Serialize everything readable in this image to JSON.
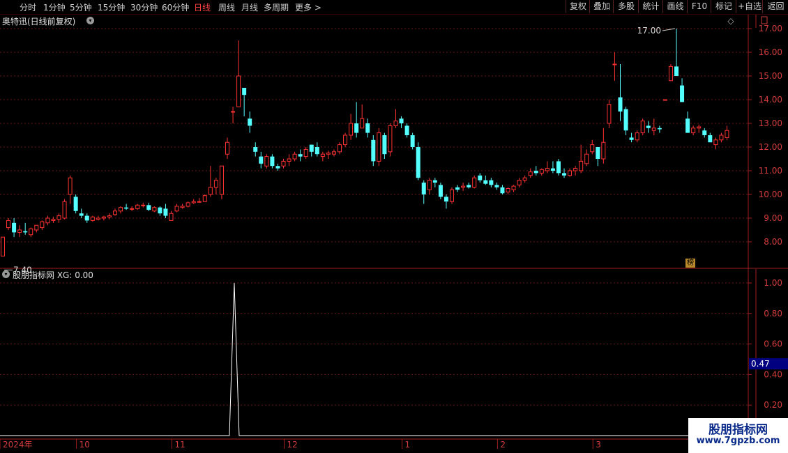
{
  "toolbar": {
    "periods": [
      "分时",
      "1分钟",
      "5分钟",
      "15分钟",
      "30分钟",
      "60分钟",
      "日线",
      "周线",
      "月线",
      "多周期",
      "更多 >"
    ],
    "active_period": "日线",
    "right_buttons": [
      "复权",
      "叠加",
      "多股",
      "统计",
      "画线",
      "F10",
      "标记",
      "+自选",
      "返回"
    ]
  },
  "stock": {
    "title": "奥特迅(日线前复权)"
  },
  "indicator": {
    "title": "股朋指标网 XG: 0.00",
    "current_value": "0.47"
  },
  "badge": "榜",
  "watermark": {
    "line1": "股朋指标网",
    "line2": "www.7gpzb.com"
  },
  "colors": {
    "up": "#ff3232",
    "down": "#54ffff",
    "axis": "#a02020",
    "grid": "#6a1818",
    "line": "#ffffff",
    "highlight": "#000080"
  },
  "chart_data": [
    {
      "type": "candlestick",
      "ylim": [
        7.0,
        17.3
      ],
      "y_ticks": [
        "17.00",
        "16.00",
        "15.00",
        "14.00",
        "13.00",
        "12.00",
        "11.00",
        "10.00",
        "9.00",
        "8.00"
      ],
      "x_labels": [
        "2024年",
        "10",
        "11",
        "12",
        "1",
        "2",
        "3"
      ],
      "x_label_index": [
        0,
        13,
        30,
        50,
        71,
        88,
        105
      ],
      "annotations": {
        "high": "17.00",
        "low": "7.40"
      },
      "ohlc": [
        [
          7.4,
          8.2,
          7.4,
          8.2
        ],
        [
          8.6,
          9.0,
          8.5,
          8.9
        ],
        [
          8.8,
          9.0,
          8.2,
          8.4
        ],
        [
          8.4,
          8.7,
          8.2,
          8.5
        ],
        [
          8.45,
          8.8,
          8.3,
          8.4
        ],
        [
          8.3,
          8.6,
          8.2,
          8.55
        ],
        [
          8.5,
          8.7,
          8.4,
          8.7
        ],
        [
          8.6,
          8.9,
          8.5,
          8.85
        ],
        [
          8.8,
          9.1,
          8.7,
          9.0
        ],
        [
          8.9,
          9.05,
          8.8,
          8.95
        ],
        [
          8.95,
          9.2,
          8.8,
          9.1
        ],
        [
          9.0,
          9.8,
          8.95,
          9.7
        ],
        [
          10.0,
          10.8,
          9.6,
          10.7
        ],
        [
          9.9,
          10.0,
          9.2,
          9.3
        ],
        [
          9.2,
          9.4,
          9.0,
          9.1
        ],
        [
          9.1,
          9.2,
          8.8,
          8.9
        ],
        [
          8.9,
          9.1,
          8.85,
          9.05
        ],
        [
          8.95,
          9.1,
          8.9,
          9.0
        ],
        [
          9.0,
          9.1,
          8.9,
          9.05
        ],
        [
          9.05,
          9.2,
          8.95,
          9.1
        ],
        [
          9.15,
          9.4,
          9.1,
          9.3
        ],
        [
          9.3,
          9.5,
          9.2,
          9.45
        ],
        [
          9.45,
          9.6,
          9.35,
          9.4
        ],
        [
          9.4,
          9.5,
          9.3,
          9.4
        ],
        [
          9.4,
          9.6,
          9.35,
          9.55
        ],
        [
          9.55,
          9.65,
          9.45,
          9.55
        ],
        [
          9.55,
          9.65,
          9.3,
          9.35
        ],
        [
          9.3,
          9.5,
          9.25,
          9.45
        ],
        [
          9.45,
          9.5,
          9.1,
          9.2
        ],
        [
          9.4,
          9.6,
          9.0,
          9.1
        ],
        [
          8.9,
          9.3,
          8.9,
          9.2
        ],
        [
          9.3,
          9.6,
          9.25,
          9.5
        ],
        [
          9.45,
          9.6,
          9.4,
          9.5
        ],
        [
          9.5,
          9.7,
          9.45,
          9.65
        ],
        [
          9.65,
          9.8,
          9.6,
          9.7
        ],
        [
          9.7,
          9.85,
          9.65,
          9.7
        ],
        [
          9.7,
          10.0,
          9.7,
          9.95
        ],
        [
          10.0,
          11.2,
          9.9,
          10.3
        ],
        [
          10.3,
          10.7,
          10.0,
          10.6
        ],
        [
          10.0,
          11.2,
          9.8,
          11.2
        ],
        [
          11.7,
          12.4,
          11.5,
          12.2
        ],
        [
          13.5,
          13.7,
          13.0,
          13.5
        ],
        [
          13.7,
          16.5,
          13.7,
          15.0
        ],
        [
          14.5,
          14.0,
          13.3,
          14.2
        ],
        [
          13.2,
          13.5,
          12.6,
          12.9
        ],
        [
          12.0,
          12.2,
          11.6,
          11.8
        ],
        [
          11.6,
          11.8,
          11.1,
          11.3
        ],
        [
          11.2,
          11.7,
          11.1,
          11.6
        ],
        [
          11.6,
          11.7,
          11.1,
          11.2
        ],
        [
          11.2,
          11.3,
          11.0,
          11.1
        ],
        [
          11.2,
          11.5,
          11.1,
          11.4
        ],
        [
          11.4,
          11.7,
          11.2,
          11.5
        ],
        [
          11.5,
          11.8,
          11.4,
          11.7
        ],
        [
          11.7,
          11.9,
          11.4,
          11.6
        ],
        [
          11.6,
          12.0,
          11.5,
          11.9
        ],
        [
          12.1,
          12.0,
          11.6,
          11.8
        ],
        [
          12.0,
          12.2,
          11.6,
          11.7
        ],
        [
          11.6,
          11.8,
          11.4,
          11.7
        ],
        [
          11.7,
          11.85,
          11.5,
          11.75
        ],
        [
          11.7,
          11.9,
          11.6,
          11.8
        ],
        [
          11.8,
          12.2,
          11.7,
          12.1
        ],
        [
          12.1,
          12.6,
          12.0,
          12.5
        ],
        [
          12.5,
          13.4,
          12.3,
          13.0
        ],
        [
          13.0,
          13.9,
          12.4,
          12.6
        ],
        [
          12.8,
          13.8,
          12.8,
          13.2
        ],
        [
          13.0,
          13.2,
          12.4,
          12.6
        ],
        [
          12.3,
          12.5,
          11.2,
          11.4
        ],
        [
          11.4,
          12.8,
          11.2,
          12.6
        ],
        [
          12.5,
          12.6,
          11.5,
          11.7
        ],
        [
          11.8,
          13.0,
          11.6,
          12.9
        ],
        [
          12.9,
          13.6,
          12.8,
          13.1
        ],
        [
          13.2,
          13.3,
          12.8,
          13.0
        ],
        [
          12.9,
          13.0,
          12.4,
          12.5
        ],
        [
          12.5,
          12.6,
          11.9,
          12.0
        ],
        [
          12.0,
          12.2,
          10.6,
          10.7
        ],
        [
          10.5,
          10.6,
          9.6,
          10.0
        ],
        [
          10.2,
          10.7,
          10.0,
          10.6
        ],
        [
          10.6,
          10.7,
          10.3,
          10.5
        ],
        [
          10.4,
          10.5,
          9.8,
          9.9
        ],
        [
          9.9,
          10.0,
          9.4,
          9.7
        ],
        [
          9.7,
          10.3,
          9.6,
          10.2
        ],
        [
          10.3,
          10.4,
          10.1,
          10.2
        ],
        [
          10.3,
          10.5,
          10.15,
          10.35
        ],
        [
          10.4,
          10.5,
          10.25,
          10.3
        ],
        [
          10.3,
          10.8,
          10.25,
          10.7
        ],
        [
          10.8,
          10.9,
          10.5,
          10.6
        ],
        [
          10.6,
          10.8,
          10.4,
          10.45
        ],
        [
          10.6,
          10.7,
          10.3,
          10.4
        ],
        [
          10.4,
          10.5,
          10.2,
          10.3
        ],
        [
          10.3,
          10.4,
          10.0,
          10.05
        ],
        [
          10.1,
          10.3,
          10.0,
          10.25
        ],
        [
          10.2,
          10.4,
          10.1,
          10.35
        ],
        [
          10.4,
          10.7,
          10.3,
          10.6
        ],
        [
          10.6,
          10.8,
          10.5,
          10.7
        ],
        [
          10.8,
          11.1,
          10.7,
          10.95
        ],
        [
          11.0,
          11.2,
          10.8,
          10.9
        ],
        [
          10.9,
          11.1,
          10.8,
          11.05
        ],
        [
          11.0,
          11.4,
          10.9,
          11.1
        ],
        [
          11.1,
          11.4,
          10.9,
          11.0
        ],
        [
          11.4,
          11.5,
          10.8,
          10.9
        ],
        [
          10.9,
          11.1,
          10.7,
          10.8
        ],
        [
          10.8,
          11.1,
          10.75,
          11.0
        ],
        [
          11.0,
          11.2,
          10.8,
          11.1
        ],
        [
          11.0,
          12.1,
          10.9,
          11.4
        ],
        [
          11.3,
          11.9,
          11.2,
          11.7
        ],
        [
          11.8,
          12.3,
          11.7,
          12.1
        ],
        [
          12.0,
          11.9,
          11.2,
          11.5
        ],
        [
          11.5,
          12.8,
          11.3,
          12.2
        ],
        [
          13.0,
          14.0,
          12.8,
          13.8
        ],
        [
          15.5,
          16.0,
          14.8,
          15.5
        ],
        [
          14.1,
          15.5,
          13.1,
          13.5
        ],
        [
          13.6,
          13.7,
          12.5,
          12.7
        ],
        [
          12.4,
          12.6,
          12.2,
          12.3
        ],
        [
          12.3,
          12.7,
          12.2,
          12.6
        ],
        [
          12.6,
          13.2,
          12.5,
          13.1
        ],
        [
          12.9,
          13.1,
          12.6,
          12.8
        ],
        [
          12.7,
          13.2,
          12.5,
          12.8
        ],
        [
          12.8,
          12.9,
          12.6,
          12.75
        ],
        [
          14.0,
          14.0,
          14.0,
          14.0
        ],
        [
          14.8,
          15.5,
          14.8,
          15.4
        ],
        [
          15.4,
          17.0,
          15.2,
          15.0
        ],
        [
          14.6,
          14.9,
          13.9,
          13.9
        ],
        [
          13.2,
          13.5,
          12.6,
          12.6
        ],
        [
          12.6,
          12.9,
          12.5,
          12.8
        ],
        [
          12.8,
          12.95,
          12.6,
          12.85
        ],
        [
          12.7,
          12.8,
          12.4,
          12.5
        ],
        [
          12.5,
          12.6,
          12.2,
          12.2
        ],
        [
          12.1,
          12.4,
          11.9,
          12.3
        ],
        [
          12.3,
          12.6,
          12.2,
          12.5
        ],
        [
          12.4,
          12.9,
          12.3,
          12.7
        ]
      ]
    },
    {
      "type": "line",
      "name": "XG",
      "ylim": [
        0,
        1.1
      ],
      "y_ticks": [
        "1.00",
        "0.80",
        "0.60",
        "0.40",
        "0.20"
      ],
      "spike_index": 39,
      "spike_value": 1.0,
      "current_value": 0.47
    }
  ]
}
